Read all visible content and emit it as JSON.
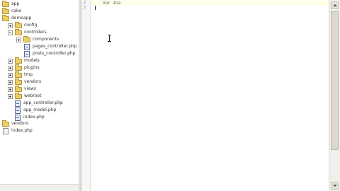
{
  "file_tree": {
    "items": [
      {
        "label": "app",
        "kind": "folder",
        "expander": "none"
      },
      {
        "label": "cake",
        "kind": "folder",
        "expander": "none"
      },
      {
        "label": "demoapp",
        "kind": "folder",
        "expander": "minus"
      },
      {
        "label": "config",
        "kind": "folder",
        "expander": "plus"
      },
      {
        "label": "controllers",
        "kind": "folder",
        "expander": "minus"
      },
      {
        "label": "components",
        "kind": "folder",
        "expander": "plus"
      },
      {
        "label": "pages_controller.php",
        "kind": "php-file",
        "expander": "none"
      },
      {
        "label": "posts_controller.php",
        "kind": "php-file",
        "expander": "none"
      },
      {
        "label": "models",
        "kind": "folder",
        "expander": "plus"
      },
      {
        "label": "plugins",
        "kind": "folder",
        "expander": "plus"
      },
      {
        "label": "tmp",
        "kind": "folder",
        "expander": "plus"
      },
      {
        "label": "vendors",
        "kind": "folder",
        "expander": "plus"
      },
      {
        "label": "views",
        "kind": "folder",
        "expander": "plus"
      },
      {
        "label": "webroot",
        "kind": "folder",
        "expander": "plus"
      },
      {
        "label": "app_controller.php",
        "kind": "php-file",
        "expander": "none"
      },
      {
        "label": "app_model.php",
        "kind": "php-file",
        "expander": "none"
      },
      {
        "label": "index.php",
        "kind": "php-file",
        "expander": "none"
      },
      {
        "label": "vendors",
        "kind": "folder",
        "expander": "none"
      },
      {
        "label": "index.php",
        "kind": "file",
        "expander": "none"
      }
    ]
  },
  "editor": {
    "line_numbers": [
      "2",
      "3"
    ],
    "code_line": "Var  Ina"
  },
  "colors": {
    "folder": "#e9cf6c",
    "current_line": "#ffffe4"
  }
}
